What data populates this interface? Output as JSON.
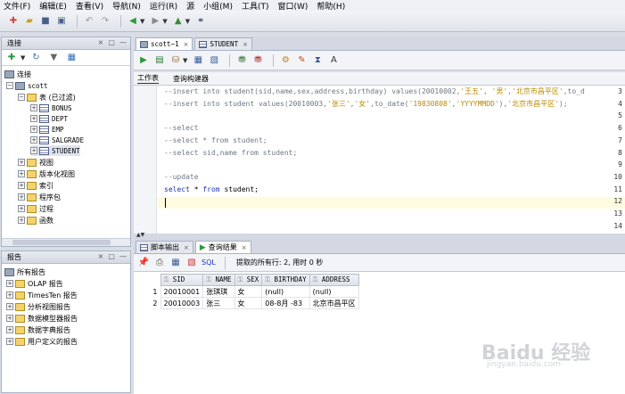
{
  "menu": [
    "文件(F)",
    "编辑(E)",
    "查看(V)",
    "导航(N)",
    "运行(R)",
    "源",
    "小组(M)",
    "工具(T)",
    "窗口(W)",
    "帮助(H)"
  ],
  "connections_panel": {
    "title": "连接",
    "tree": {
      "root": "连接",
      "connection": "scott",
      "tables_folder": "表 (已过滤)",
      "tables": [
        "BONUS",
        "DEPT",
        "EMP",
        "SALGRADE",
        "STUDENT"
      ],
      "folders": [
        "视图",
        "版本化视图",
        "索引",
        "程序包",
        "过程",
        "函数"
      ]
    }
  },
  "reports_panel": {
    "title": "报告",
    "items": [
      "所有报告",
      "OLAP 报告",
      "TimesTen 报告",
      "分析视图报告",
      "数据模型器报告",
      "数据字典报告",
      "用户定义的报告"
    ]
  },
  "editor": {
    "tabs": [
      "scott~1",
      "STUDENT"
    ],
    "subtabs": [
      "工作表",
      "查询构建器"
    ],
    "lines": [
      {
        "n": "3",
        "parts": [
          {
            "c": "cmt",
            "t": "--insert into student(sid,name,sex,address,birthday) values(20010002,"
          },
          {
            "c": "str",
            "t": "'王五'"
          },
          {
            "c": "cmt",
            "t": ", "
          },
          {
            "c": "str",
            "t": "'男'"
          },
          {
            "c": "cmt",
            "t": ","
          },
          {
            "c": "str",
            "t": "'北京市昌平区'"
          },
          {
            "c": "cmt",
            "t": ",to_d"
          }
        ]
      },
      {
        "n": "4",
        "parts": [
          {
            "c": "cmt",
            "t": "--insert into student values(20010003,"
          },
          {
            "c": "str",
            "t": "'张三'"
          },
          {
            "c": "cmt",
            "t": ","
          },
          {
            "c": "str",
            "t": "'女'"
          },
          {
            "c": "cmt",
            "t": ",to_date("
          },
          {
            "c": "str",
            "t": "'19830808'"
          },
          {
            "c": "cmt",
            "t": ","
          },
          {
            "c": "str",
            "t": "'YYYYMMDD'"
          },
          {
            "c": "cmt",
            "t": "),"
          },
          {
            "c": "str",
            "t": "'北京市昌平区'"
          },
          {
            "c": "cmt",
            "t": ");"
          }
        ]
      },
      {
        "n": "5",
        "parts": []
      },
      {
        "n": "6",
        "parts": [
          {
            "c": "cmt",
            "t": "--select"
          }
        ]
      },
      {
        "n": "7",
        "parts": [
          {
            "c": "cmt",
            "t": "--select * from student;"
          }
        ]
      },
      {
        "n": "8",
        "parts": [
          {
            "c": "cmt",
            "t": "--select sid,name from student;"
          }
        ]
      },
      {
        "n": "9",
        "parts": []
      },
      {
        "n": "10",
        "parts": [
          {
            "c": "cmt",
            "t": "--update"
          }
        ]
      },
      {
        "n": "11",
        "parts": [
          {
            "c": "kw",
            "t": "select"
          },
          {
            "c": "",
            "t": " * "
          },
          {
            "c": "kw",
            "t": "from"
          },
          {
            "c": "",
            "t": " student;"
          }
        ]
      },
      {
        "n": "12",
        "parts": []
      },
      {
        "n": "13",
        "parts": []
      },
      {
        "n": "14",
        "parts": []
      }
    ]
  },
  "output": {
    "tabs": [
      "脚本输出",
      "查询结果"
    ],
    "sql_label": "SQL",
    "status": "提取的所有行: 2, 用时 0 秒",
    "columns": [
      "SID",
      "NAME",
      "SEX",
      "BIRTHDAY",
      "ADDRESS"
    ],
    "rows": [
      {
        "n": "1",
        "cells": [
          "20010001",
          "张琪琪",
          "女",
          "(null)",
          "(null)"
        ]
      },
      {
        "n": "2",
        "cells": [
          "20010003",
          "张三",
          "女",
          "08-8月 -83",
          "北京市昌平区"
        ]
      }
    ]
  },
  "watermark": {
    "main": "Baidu 经验",
    "sub": "jingyan.baidu.com"
  }
}
